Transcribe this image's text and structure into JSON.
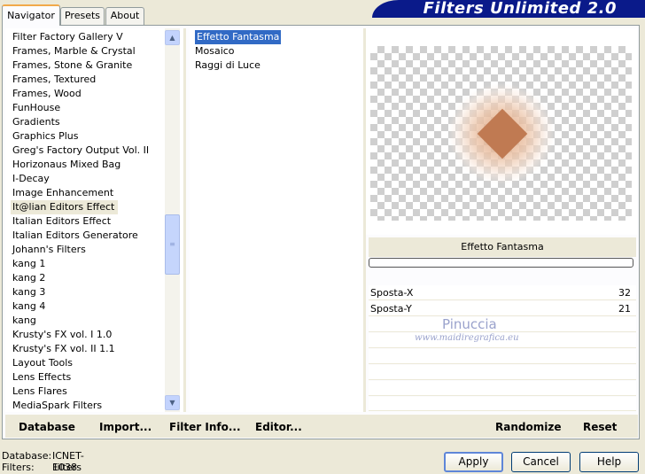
{
  "tabs": [
    "Navigator",
    "Presets",
    "About"
  ],
  "banner": {
    "title": "Filters Unlimited 2.0"
  },
  "categories": [
    "Filter Factory Gallery V",
    "Frames, Marble & Crystal",
    "Frames, Stone & Granite",
    "Frames, Textured",
    "Frames, Wood",
    "FunHouse",
    "Gradients",
    "Graphics Plus",
    "Greg's Factory Output Vol. II",
    "Horizonaus Mixed Bag",
    "I-Decay",
    "Image Enhancement",
    "It@lian Editors Effect",
    "Italian Editors Effect",
    "Italian Editors Generatore",
    "Johann's Filters",
    "kang 1",
    "kang 2",
    "kang 3",
    "kang 4",
    "kang",
    "Krusty's FX vol. I 1.0",
    "Krusty's FX vol. II 1.1",
    "Layout Tools",
    "Lens Effects",
    "Lens Flares",
    "MediaSpark Filters"
  ],
  "selected_category": "It@lian Editors Effect",
  "filters": [
    "Effetto Fantasma",
    "Mosaico",
    "Raggi di Luce"
  ],
  "selected_filter": "Effetto Fantasma",
  "preview": {
    "effect_name": "Effetto Fantasma"
  },
  "params": [
    {
      "label": "Sposta-X",
      "value": "32"
    },
    {
      "label": "Sposta-Y",
      "value": "21"
    }
  ],
  "watermark": {
    "line1": "Pinuccia",
    "line2": "www.maidiregrafica.eu"
  },
  "bottom_links": {
    "database": "Database",
    "import": "Import...",
    "filter_info": "Filter Info...",
    "editor": "Editor...",
    "randomize": "Randomize",
    "reset": "Reset"
  },
  "status": {
    "database_label": "Database:",
    "database_value": "ICNET-Filters",
    "filters_label": "Filters:",
    "filters_value": "1038"
  },
  "buttons": {
    "apply": "Apply",
    "cancel": "Cancel",
    "help": "Help"
  },
  "colors": {
    "banner": "#0a1a8a",
    "selection": "#316ac5",
    "diamond": "#c07a52"
  }
}
